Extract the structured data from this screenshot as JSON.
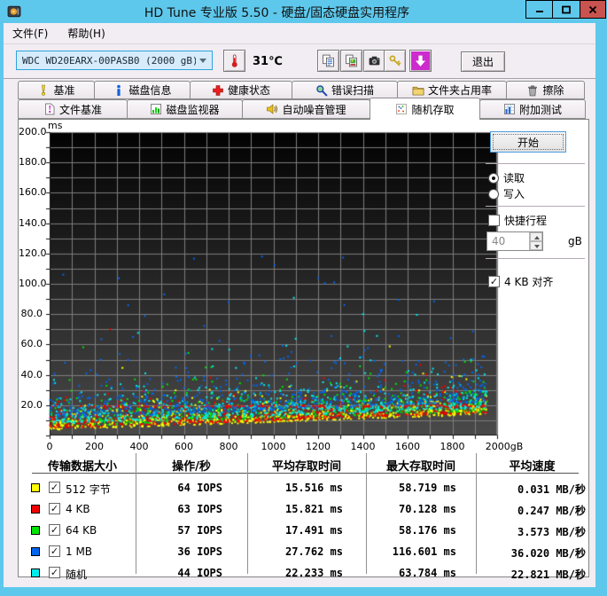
{
  "window": {
    "title": "HD Tune 专业版 5.50 - 硬盘/固态硬盘实用程序"
  },
  "menu": {
    "items": [
      {
        "label": "文件(F)"
      },
      {
        "label": "帮助(H)"
      }
    ]
  },
  "toolbar": {
    "drive_selector": {
      "value": "WDC WD20EARX-00PASB0 (2000 gB)"
    },
    "temperature": "31℃",
    "exit_label": "退出",
    "button_icons": [
      "thermometer-icon",
      "copy-text-icon",
      "copy-image-icon",
      "camera-icon",
      "keys-icon",
      "down-arrow-icon"
    ]
  },
  "tabs": {
    "active": "random-access",
    "row1": [
      {
        "id": "benchmark",
        "label": "基准"
      },
      {
        "id": "disk-info",
        "label": "磁盘信息"
      },
      {
        "id": "health",
        "label": "健康状态"
      },
      {
        "id": "error-scan",
        "label": "错误扫描"
      },
      {
        "id": "folder-usage",
        "label": "文件夹占用率"
      },
      {
        "id": "erase",
        "label": "擦除"
      }
    ],
    "row2": [
      {
        "id": "file-benchmark",
        "label": "文件基准"
      },
      {
        "id": "disk-monitor",
        "label": "磁盘监视器"
      },
      {
        "id": "aam",
        "label": "自动噪音管理"
      },
      {
        "id": "random-access",
        "label": "随机存取"
      },
      {
        "id": "extra-tests",
        "label": "附加测试"
      }
    ]
  },
  "controls": {
    "start_button": "开始",
    "mode_options": [
      {
        "id": "read",
        "label": "读取",
        "selected": true
      },
      {
        "id": "write",
        "label": "写入",
        "selected": false
      }
    ],
    "short_stroke": {
      "label": "快捷行程",
      "checked": false,
      "value": "40",
      "unit": "gB",
      "enabled": false
    },
    "align_4kb": {
      "label": "4 KB 对齐",
      "checked": true
    }
  },
  "table": {
    "headers": [
      "传输数据大小",
      "操作/秒",
      "平均存取时间",
      "最大存取时间",
      "平均速度"
    ]
  },
  "chart_data": {
    "type": "scatter",
    "y_unit_label": "ms",
    "xlim": [
      0,
      2000
    ],
    "ylim": [
      0,
      200
    ],
    "x_tick_labels": [
      "0",
      "200",
      "400",
      "600",
      "800",
      "1000",
      "1200",
      "1400",
      "1600",
      "1800",
      "2000gB"
    ],
    "y_tick_labels": [
      "200.0",
      "180.0",
      "160.0",
      "140.0",
      "120.0",
      "100.0",
      "80.0",
      "60.0",
      "40.0",
      "20.0"
    ],
    "grid": {
      "x_minor_step": 100,
      "y_minor_step": 10,
      "color": "#7d7d7d",
      "on": true
    },
    "plot_background": {
      "top": "#030303",
      "bottom": "#4a4a4a"
    },
    "x_data_extent": 1955,
    "legend_position": "bottom-table",
    "series": [
      {
        "id": "512b",
        "label": "512 字节",
        "color": "#ffff00",
        "enabled": true,
        "stats": {
          "iops": "64 IOPS",
          "avg": "15.516 ms",
          "max": "58.719 ms",
          "speed": "0.031 MB/秒"
        },
        "render_model": {
          "order": 2,
          "count": 680,
          "base_start": 3.5,
          "base_end": 14,
          "tail": 5,
          "cap": 50,
          "hi": {
            "frac": 0.004,
            "min": 28,
            "max": 50
          },
          "max_point": [
            1520,
            58.719
          ]
        }
      },
      {
        "id": "4kb",
        "label": "4 KB",
        "color": "#f20000",
        "enabled": true,
        "stats": {
          "iops": "63 IOPS",
          "avg": "15.821 ms",
          "max": "70.128 ms",
          "speed": "0.247 MB/秒"
        },
        "render_model": {
          "order": 3,
          "count": 680,
          "base_start": 4.5,
          "base_end": 15,
          "tail": 5,
          "cap": 52,
          "line": {
            "y": 19.2,
            "frac": 0.26,
            "xmin": 120
          },
          "hi": {
            "frac": 0.005,
            "min": 30,
            "max": 60
          },
          "max_point": [
            270,
            70.128
          ]
        }
      },
      {
        "id": "64kb",
        "label": "64 KB",
        "color": "#00e400",
        "enabled": true,
        "stats": {
          "iops": "57 IOPS",
          "avg": "17.491 ms",
          "max": "58.176 ms",
          "speed": "3.573 MB/秒"
        },
        "render_model": {
          "order": 1,
          "count": 680,
          "base_start": 5.5,
          "base_end": 16,
          "tail": 6,
          "cap": 54,
          "hi": {
            "frac": 0.006,
            "min": 30,
            "max": 56
          },
          "max_point": [
            150,
            58.176
          ]
        }
      },
      {
        "id": "1mb",
        "label": "1 MB",
        "color": "#0066f2",
        "enabled": true,
        "stats": {
          "iops": "36 IOPS",
          "avg": "27.762 ms",
          "max": "116.601 ms",
          "speed": "36.020 MB/秒"
        },
        "render_model": {
          "order": 5,
          "count": 620,
          "base_start": 11,
          "base_end": 22,
          "tail": 9.5,
          "cap": 68,
          "hi": {
            "frac": 0.04,
            "min": 45,
            "max": 118
          },
          "max_point": [
            645,
            116.601
          ]
        }
      },
      {
        "id": "random",
        "label": "随机",
        "color": "#00ecec",
        "enabled": true,
        "stats": {
          "iops": "44 IOPS",
          "avg": "22.233 ms",
          "max": "63.784 ms",
          "speed": "22.821 MB/秒"
        },
        "render_model": {
          "order": 4,
          "count": 650,
          "base_start": 7.5,
          "base_end": 18,
          "tail": 7,
          "cap": 60,
          "hi": {
            "frac": 0.02,
            "min": 40,
            "max": 92
          },
          "max_point": [
            1100,
            63.784
          ]
        }
      }
    ]
  },
  "colors": {
    "window_border": "#5ec8ec",
    "close_button": "#c9534e",
    "client_bg": "#f1edf2",
    "panel_bg": "#ffffff"
  }
}
